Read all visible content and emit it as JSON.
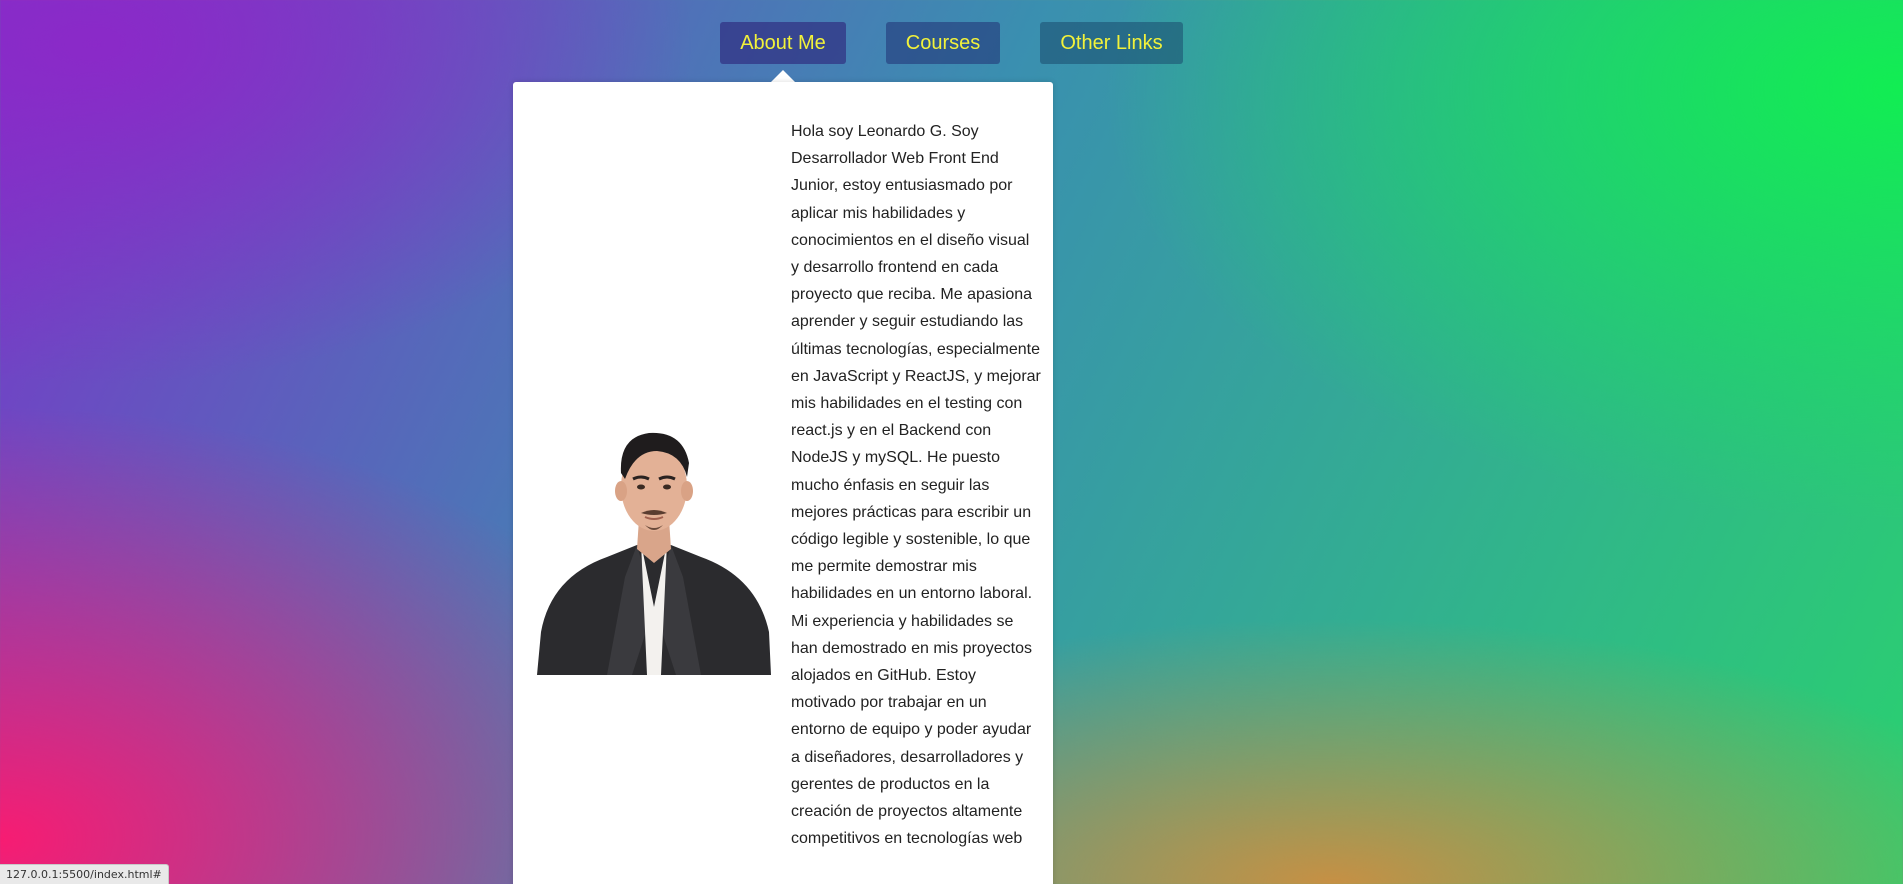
{
  "nav": {
    "items": [
      {
        "label": "About Me",
        "active": true
      },
      {
        "label": "Courses",
        "active": false
      },
      {
        "label": "Other Links",
        "active": false
      }
    ]
  },
  "about": {
    "bio": "Hola soy Leonardo G. Soy Desarrollador Web Front End Junior, estoy entusiasmado por aplicar mis habilidades y conocimientos en el diseño visual y desarrollo frontend en cada proyecto que reciba. Me apasiona aprender y seguir estudiando las últimas tecnologías, especialmente en JavaScript y ReactJS, y mejorar mis habilidades en el testing con react.js y en el Backend con NodeJS y mySQL. He puesto mucho énfasis en seguir las mejores prácticas para escribir un código legible y sostenible, lo que me permite demostrar mis habilidades en un entorno laboral. Mi experiencia y habilidades se han demostrado en mis proyectos alojados en GitHub. Estoy motivado por trabajar en un entorno de equipo y poder ayudar a diseñadores, desarrolladores y gerentes de productos en la creación de proyectos altamente competitivos en tecnologías web"
  },
  "status_bar": {
    "url": "127.0.0.1:5500/index.html#"
  },
  "colors": {
    "nav_text": "#f2f23a",
    "panel_bg": "#ffffff"
  }
}
